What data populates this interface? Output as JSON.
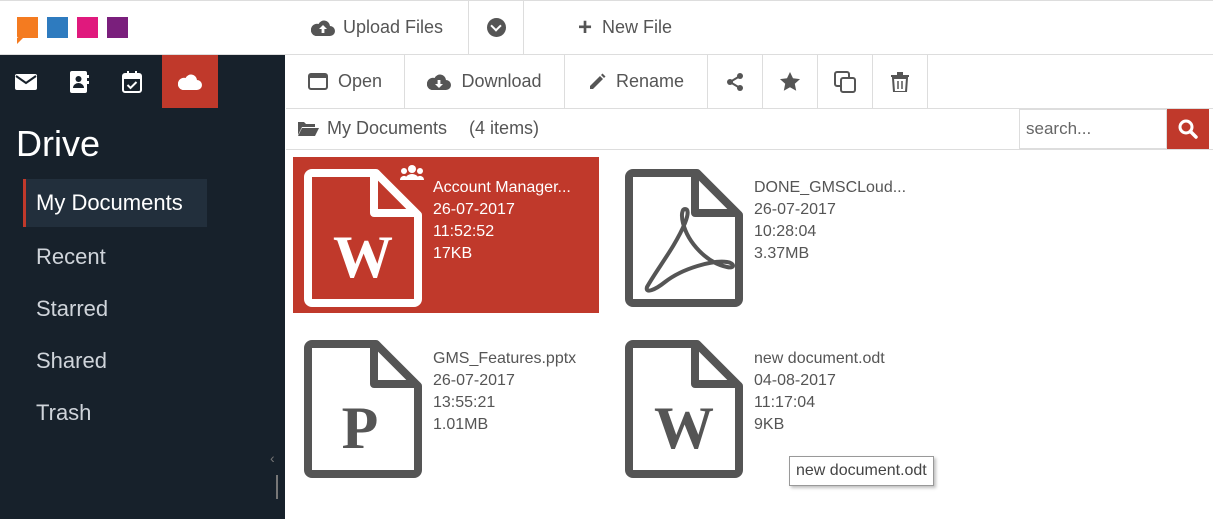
{
  "topbar": {
    "upload_label": "Upload Files",
    "new_file_label": "New File"
  },
  "sidebar": {
    "title": "Drive",
    "apps": [
      "mail",
      "contacts",
      "calendar",
      "drive"
    ],
    "nav": [
      {
        "label": "My Documents",
        "active": true
      },
      {
        "label": "Recent"
      },
      {
        "label": "Starred"
      },
      {
        "label": "Shared"
      },
      {
        "label": "Trash"
      }
    ]
  },
  "actions": {
    "open": "Open",
    "download": "Download",
    "rename": "Rename"
  },
  "path": {
    "folder": "My Documents",
    "count": "(4 items)"
  },
  "search": {
    "placeholder": "search..."
  },
  "files": [
    {
      "name": "Account Manager...",
      "date": "26-07-2017",
      "time": "11:52:52",
      "size": "17KB",
      "type": "word",
      "selected": true,
      "shared": true
    },
    {
      "name": "DONE_GMSCLoud...",
      "date": "26-07-2017",
      "time": "10:28:04",
      "size": "3.37MB",
      "type": "pdf"
    },
    {
      "name": "GMS_Features.pptx",
      "date": "26-07-2017",
      "time": "13:55:21",
      "size": "1.01MB",
      "type": "powerpoint"
    },
    {
      "name": "new document.odt",
      "date": "04-08-2017",
      "time": "11:17:04",
      "size": "9KB",
      "type": "word"
    }
  ],
  "tooltip": "new document.odt",
  "colors": {
    "accent": "#c0392b",
    "sidebar": "#17212b"
  }
}
